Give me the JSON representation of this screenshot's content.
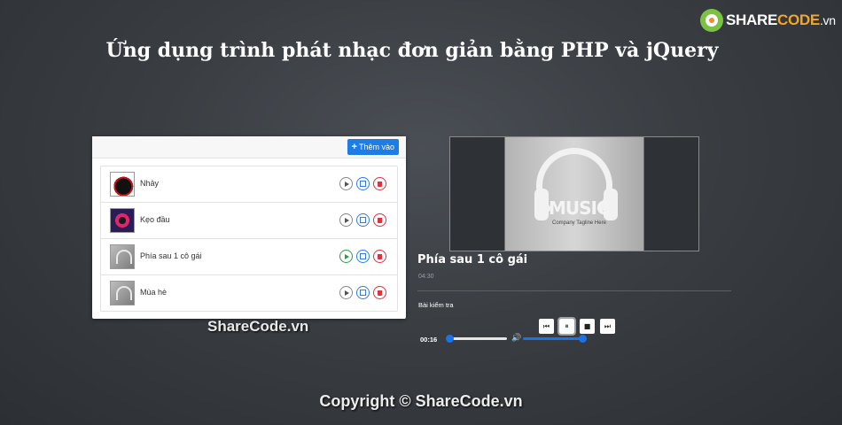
{
  "brand": {
    "part1": "SHARE",
    "part2": "CODE",
    "part3": ".vn"
  },
  "page_title": "Ứng dụng trình phát nhạc đơn giản bằng PHP và jQuery",
  "playlist": {
    "add_label": "Thêm vào",
    "items": [
      {
        "label": "Nhảy",
        "active": false
      },
      {
        "label": "Kẹo đầu",
        "active": false
      },
      {
        "label": "Phía sau 1 cô gái",
        "active": true
      },
      {
        "label": "Mùa hè",
        "active": false
      }
    ]
  },
  "watermark": "ShareCode.vn",
  "now_playing": {
    "cover_text": "MUSIC",
    "cover_tagline": "Company Tagline Here",
    "title": "Phía sau 1 cô gái",
    "duration": "04:30",
    "artist": "Bài kiểm tra",
    "elapsed": "00:16",
    "progress": 0.06,
    "volume": 1.0
  },
  "colors": {
    "accent": "#1a73e8",
    "play_active": "#2e9e44",
    "delete": "#d9343f",
    "edit": "#2f7de1"
  },
  "footer": "Copyright © ShareCode.vn"
}
